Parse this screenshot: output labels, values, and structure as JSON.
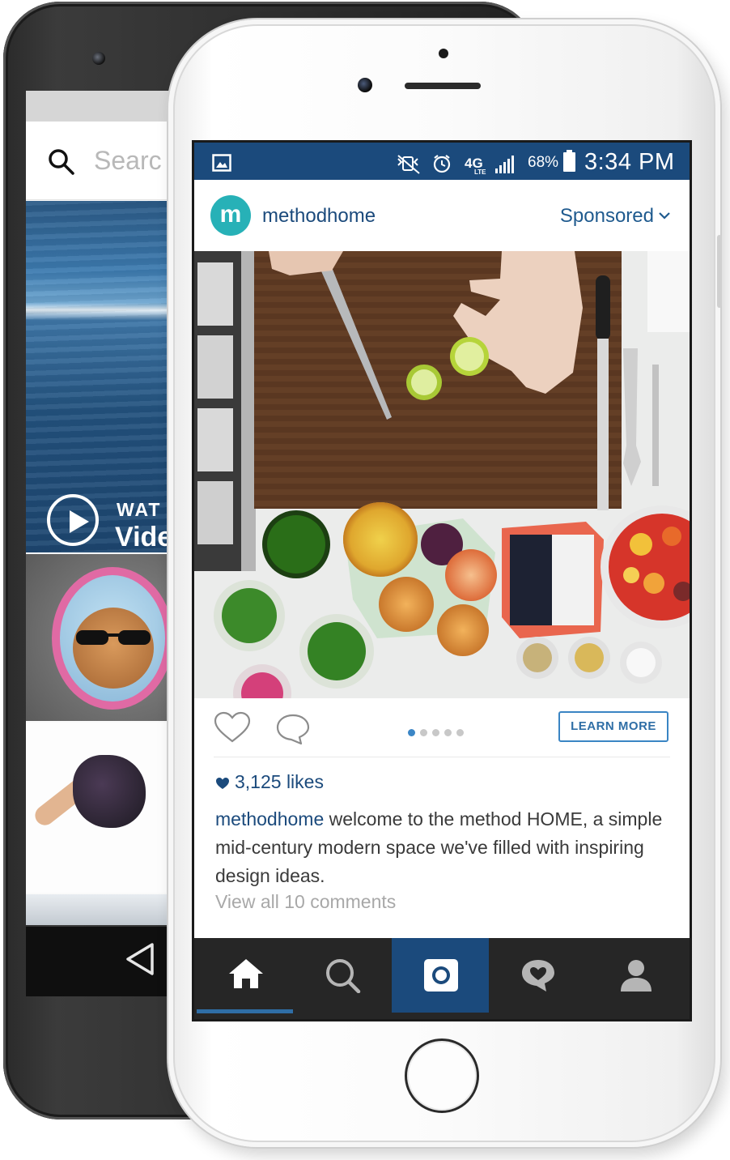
{
  "back_phone": {
    "search_placeholder": "Searc",
    "video_overlay": {
      "line1": "WAT",
      "line2": "Vide"
    }
  },
  "status_bar": {
    "battery": "68%",
    "network": "4G",
    "network_sub": "LTE",
    "time": "3:34 PM"
  },
  "post": {
    "username": "methodhome",
    "avatar_letter": "m",
    "sponsored": "Sponsored",
    "cta": "LEARN MORE",
    "carousel": {
      "count": 5,
      "active": 0
    },
    "likes": "3,125 likes",
    "caption_user": "methodhome",
    "caption_text": "welcome to the method HOME, a simple mid-century modern space we've filled with inspiring design ideas.",
    "view_comments": "View all 10 comments"
  },
  "tab_bar": {
    "active": "home",
    "tabs": [
      "home",
      "search",
      "camera",
      "activity",
      "profile"
    ]
  },
  "colors": {
    "brand_blue": "#1b4a7c",
    "link_blue": "#3a85c4",
    "avatar_teal": "#27b1b7",
    "tabbar_dark": "#262626"
  }
}
